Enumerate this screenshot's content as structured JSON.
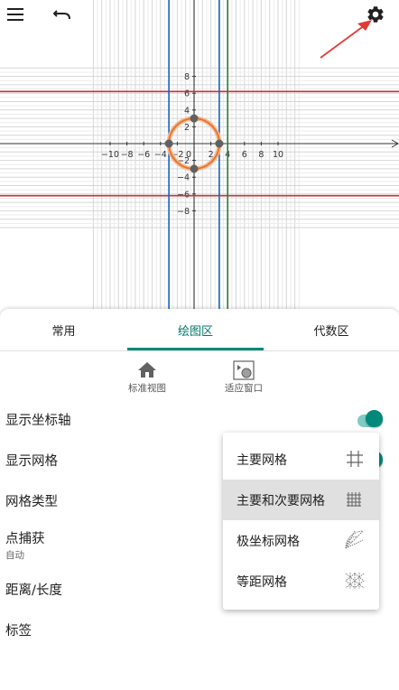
{
  "graph": {
    "x_ticks": [
      "−10",
      "−8",
      "−6",
      "−4",
      "−2",
      "0",
      "2",
      "4",
      "6",
      "8",
      "10"
    ],
    "y_ticks": [
      "8",
      "6",
      "4",
      "2",
      "−2",
      "−4",
      "−6",
      "−8"
    ],
    "colors": {
      "red": "#d32f2f",
      "blue": "#1565c0",
      "green": "#2e7d32",
      "circle": "#e8712e",
      "point": "#616161",
      "arrow": "#e53935"
    }
  },
  "toolbar": {
    "menu_icon": "menu-icon",
    "undo_icon": "undo-icon",
    "settings_icon": "gear-icon"
  },
  "tabs": [
    {
      "label": "常用"
    },
    {
      "label": "绘图区"
    },
    {
      "label": "代数区"
    }
  ],
  "tools": [
    {
      "label": "标准视图",
      "icon": "home-icon"
    },
    {
      "label": "适应窗口",
      "icon": "fit-window-icon"
    }
  ],
  "settings": {
    "show_axes": "显示坐标轴",
    "show_grid": "显示网格",
    "grid_type": "网格类型",
    "point_capture": "点捕获",
    "point_capture_value": "自动",
    "distance": "距离/长度",
    "labels": "标签"
  },
  "grid_menu": {
    "items": [
      {
        "label": "主要网格",
        "icon": "major-grid-icon"
      },
      {
        "label": "主要和次要网格",
        "icon": "major-minor-grid-icon",
        "selected": true
      },
      {
        "label": "极坐标网格",
        "icon": "polar-grid-icon"
      },
      {
        "label": "等距网格",
        "icon": "isometric-grid-icon"
      }
    ]
  }
}
